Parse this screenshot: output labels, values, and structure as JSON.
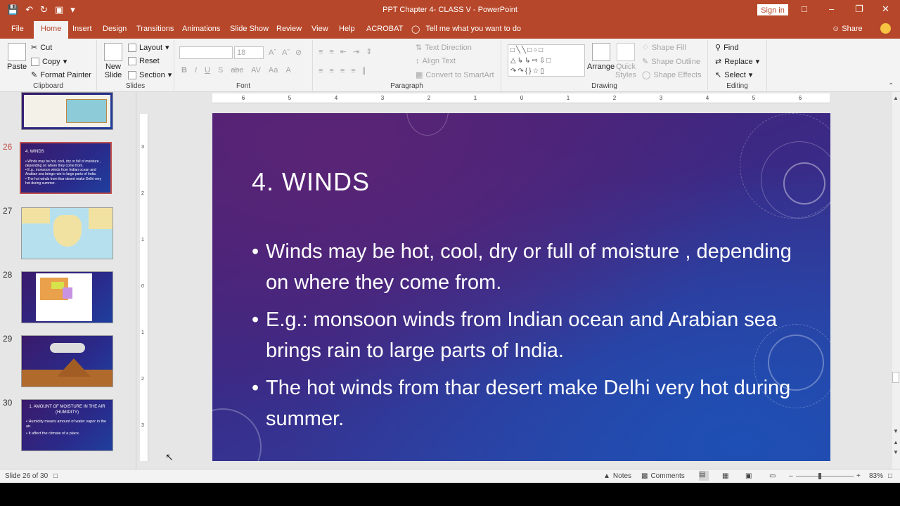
{
  "window": {
    "title": "PPT Chapter 4- CLASS V  -  PowerPoint",
    "sign_in": "Sign in"
  },
  "tabs": [
    "File",
    "Home",
    "Insert",
    "Design",
    "Transitions",
    "Animations",
    "Slide Show",
    "Review",
    "View",
    "Help",
    "ACROBAT"
  ],
  "active_tab": "Home",
  "tell_me": "Tell me what you want to do",
  "share": "Share",
  "ribbon": {
    "clipboard": {
      "paste": "Paste",
      "cut": "Cut",
      "copy": "Copy",
      "format_painter": "Format Painter",
      "label": "Clipboard"
    },
    "slides": {
      "new_slide": "New Slide",
      "layout": "Layout",
      "reset": "Reset",
      "section": "Section",
      "label": "Slides"
    },
    "font": {
      "size": "18",
      "label": "Font"
    },
    "paragraph": {
      "text_direction": "Text Direction",
      "align_text": "Align Text",
      "convert_smartart": "Convert to SmartArt",
      "label": "Paragraph"
    },
    "drawing": {
      "arrange": "Arrange",
      "quick_styles": "Quick Styles",
      "shape_fill": "Shape Fill",
      "shape_outline": "Shape Outline",
      "shape_effects": "Shape Effects",
      "label": "Drawing"
    },
    "editing": {
      "find": "Find",
      "replace": "Replace",
      "select": "Select",
      "label": "Editing"
    }
  },
  "thumbnails": [
    {
      "num": "",
      "kind": "slide25"
    },
    {
      "num": "26",
      "kind": "text",
      "title": "4. WINDS",
      "lines": [
        "• Winds may be hot, cool, dry or full of moisture , depending on where they come from.",
        "• E.g.: monsoon winds from Indian ocean and Arabian sea brings rain to large parts of India.",
        "• The hot winds from thar desert make Delhi very hot during summer."
      ]
    },
    {
      "num": "27",
      "kind": "map"
    },
    {
      "num": "28",
      "kind": "india"
    },
    {
      "num": "29",
      "kind": "diagram"
    },
    {
      "num": "30",
      "kind": "text",
      "title": "1. AMOUNT OF MOISTURE IN THE AIR (HUMIDITY)",
      "lines": [
        "• Humidity means amount of water vapor in the air.",
        "• It affect the climate of a place."
      ]
    }
  ],
  "slide": {
    "title": "4. WINDS",
    "bullets": [
      "Winds may be hot, cool, dry or full of moisture , depending on where they come from.",
      "E.g.: monsoon winds from Indian ocean and Arabian sea brings rain to large parts of India.",
      "The hot winds from thar desert make Delhi very hot during summer."
    ]
  },
  "status": {
    "slide_info": "Slide 26 of 30",
    "notes": "Notes",
    "comments": "Comments",
    "zoom": "83%"
  },
  "colors": {
    "accent": "#b7472a",
    "ribbon_bg": "#f3f3f3",
    "selected_thumb": "#c0504d"
  }
}
